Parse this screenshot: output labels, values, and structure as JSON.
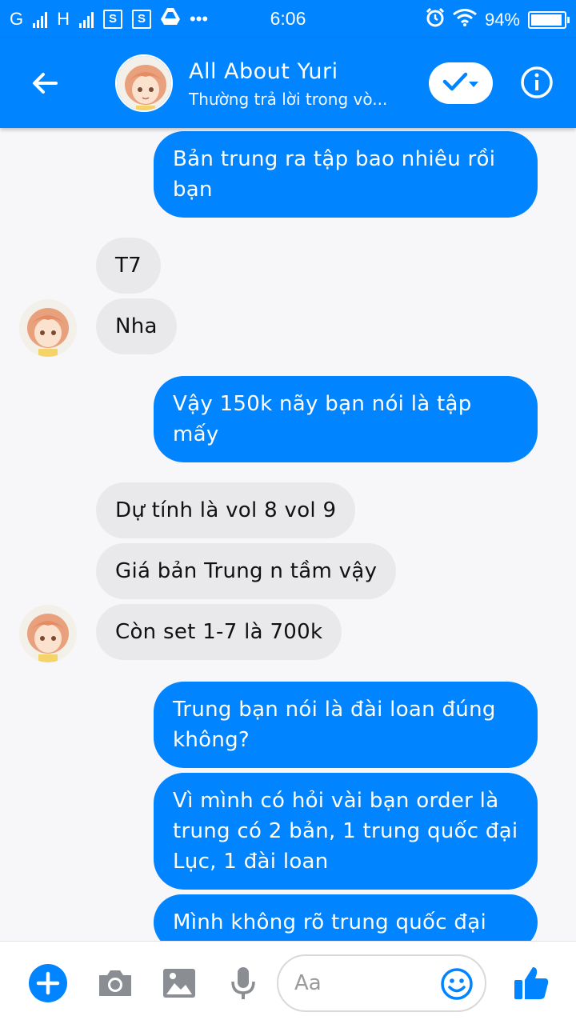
{
  "status_bar": {
    "carrier1": "G",
    "carrier2": "H",
    "time": "6:06",
    "battery": "94%",
    "battery_level": 0.94
  },
  "header": {
    "title": "All About Yuri",
    "subtitle": "Thường trả lời trong vò..."
  },
  "messages": [
    {
      "direction": "out",
      "text": "Bản trung ra tập bao nhiêu rồi bạn"
    },
    {
      "direction": "in",
      "text": "T7"
    },
    {
      "direction": "in",
      "text": "Nha"
    },
    {
      "direction": "out",
      "text": "Vậy 150k nãy bạn nói là tập mấy"
    },
    {
      "direction": "in",
      "text": "Dự tính là vol 8 vol 9"
    },
    {
      "direction": "in",
      "text": "Giá bản Trung n tầm vậy"
    },
    {
      "direction": "in",
      "text": "Còn set 1-7 là 700k"
    },
    {
      "direction": "out",
      "text": "Trung bạn nói là đài loan đúng không?"
    },
    {
      "direction": "out",
      "text": "Vì mình có hỏi vài bạn order là trung có 2 bản, 1 trung quốc đại Lục, 1 đài loan"
    },
    {
      "direction": "out",
      "text": "Mình không rõ trung quốc đại"
    }
  ],
  "composer": {
    "placeholder": "Aa"
  },
  "colors": {
    "accent": "#0084ff",
    "incoming_bubble": "#e9e9eb",
    "background": "#f7f7f9"
  },
  "icons": [
    "back-arrow-icon",
    "check-icon",
    "chevron-down-icon",
    "info-icon",
    "plus-icon",
    "camera-icon",
    "image-icon",
    "microphone-icon",
    "emoji-icon",
    "thumbs-up-icon"
  ]
}
